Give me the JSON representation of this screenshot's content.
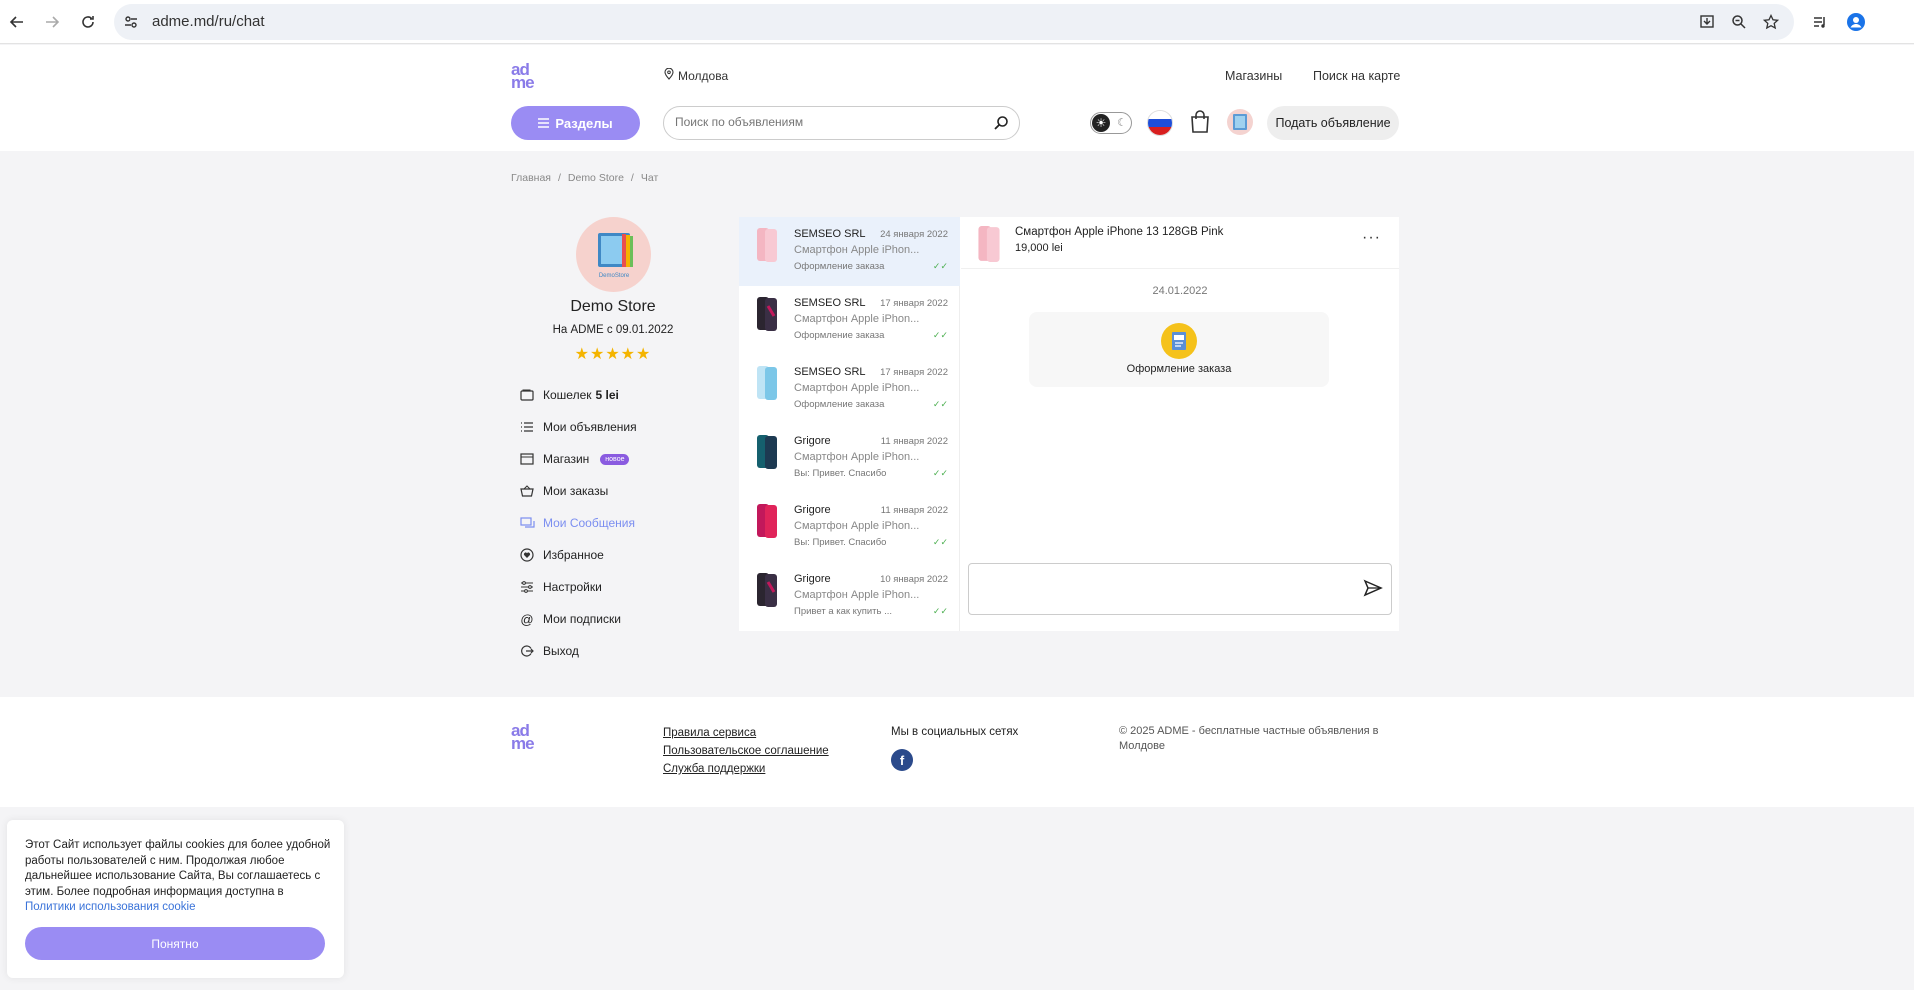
{
  "browser": {
    "url": "adme.md/ru/chat",
    "icons": [
      "back-icon",
      "forward-icon",
      "reload-icon",
      "site-settings-icon",
      "install-icon",
      "zoom-icon",
      "star-icon",
      "media-icon",
      "profile-icon"
    ]
  },
  "header": {
    "logo": [
      "ad",
      "me"
    ],
    "location": "Молдова",
    "links": [
      "Магазины",
      "Поиск на карте"
    ],
    "sections_button": "Разделы",
    "search_placeholder": "Поиск по объявлениям",
    "post_ad": "Подать объявление"
  },
  "breadcrumb": [
    "Главная",
    "Demo Store",
    "Чат"
  ],
  "profile": {
    "avatar_text": "DemoStore",
    "name": "Demo Store",
    "since": "На ADME с 09.01.2022",
    "stars": "★★★★★"
  },
  "menu": {
    "wallet_label": "Кошелек",
    "wallet_amount": "5 lei",
    "my_ads": "Мои объявления",
    "shop": "Магазин",
    "shop_badge": "новое",
    "orders": "Мои заказы",
    "messages": "Мои Сообщения",
    "favorites": "Избранное",
    "settings": "Настройки",
    "subscriptions": "Мои подписки",
    "logout": "Выход"
  },
  "chats": [
    {
      "name": "SEMSEO SRL",
      "date": "24 января 2022",
      "message": "Смартфон Apple iPhon...",
      "status": "Оформление заказа"
    },
    {
      "name": "SEMSEO SRL",
      "date": "17 января 2022",
      "message": "Смартфон Apple iPhon...",
      "status": "Оформление заказа"
    },
    {
      "name": "SEMSEO SRL",
      "date": "17 января 2022",
      "message": "Смартфон Apple iPhon...",
      "status": "Оформление заказа"
    },
    {
      "name": "Grigore",
      "date": "11 января 2022",
      "message": "Смартфон Apple iPhon...",
      "status": "Вы: Привет. Спасибо"
    },
    {
      "name": "Grigore",
      "date": "11 января 2022",
      "message": "Смартфон Apple iPhon...",
      "status": "Вы: Привет. Спасибо"
    },
    {
      "name": "Grigore",
      "date": "10 января 2022",
      "message": "Смартфон Apple iPhon...",
      "status": "Привет а как купить ..."
    }
  ],
  "conversation": {
    "product_title": "Смартфон Apple iPhone 13 128GB Pink",
    "price": "19,000 lei",
    "more": "···",
    "date": "24.01.2022",
    "order_label": "Оформление заказа",
    "input_value": ""
  },
  "footer": {
    "links": [
      "Правила сервиса",
      "Пользовательское соглашение",
      "Служба поддержки"
    ],
    "social_title": "Мы в социальных сетях",
    "fb": "f",
    "copyright": "© 2025 ADME - бесплатные частные объявления в Молдове"
  },
  "cookie": {
    "text": "Этот Сайт использует файлы cookies для более удобной работы пользователей с ним. Продолжая любое дальнейшее использование Сайта, Вы соглашаетесь с этим. Более подробная информация доступна в ",
    "link": "Политики использования cookie",
    "button": "Понятно"
  },
  "colors": {
    "accent": "#9a8cf3",
    "active_menu": "#7b8ef0",
    "selected_chat": "#eaf1fb",
    "stars": "#f4b400"
  }
}
